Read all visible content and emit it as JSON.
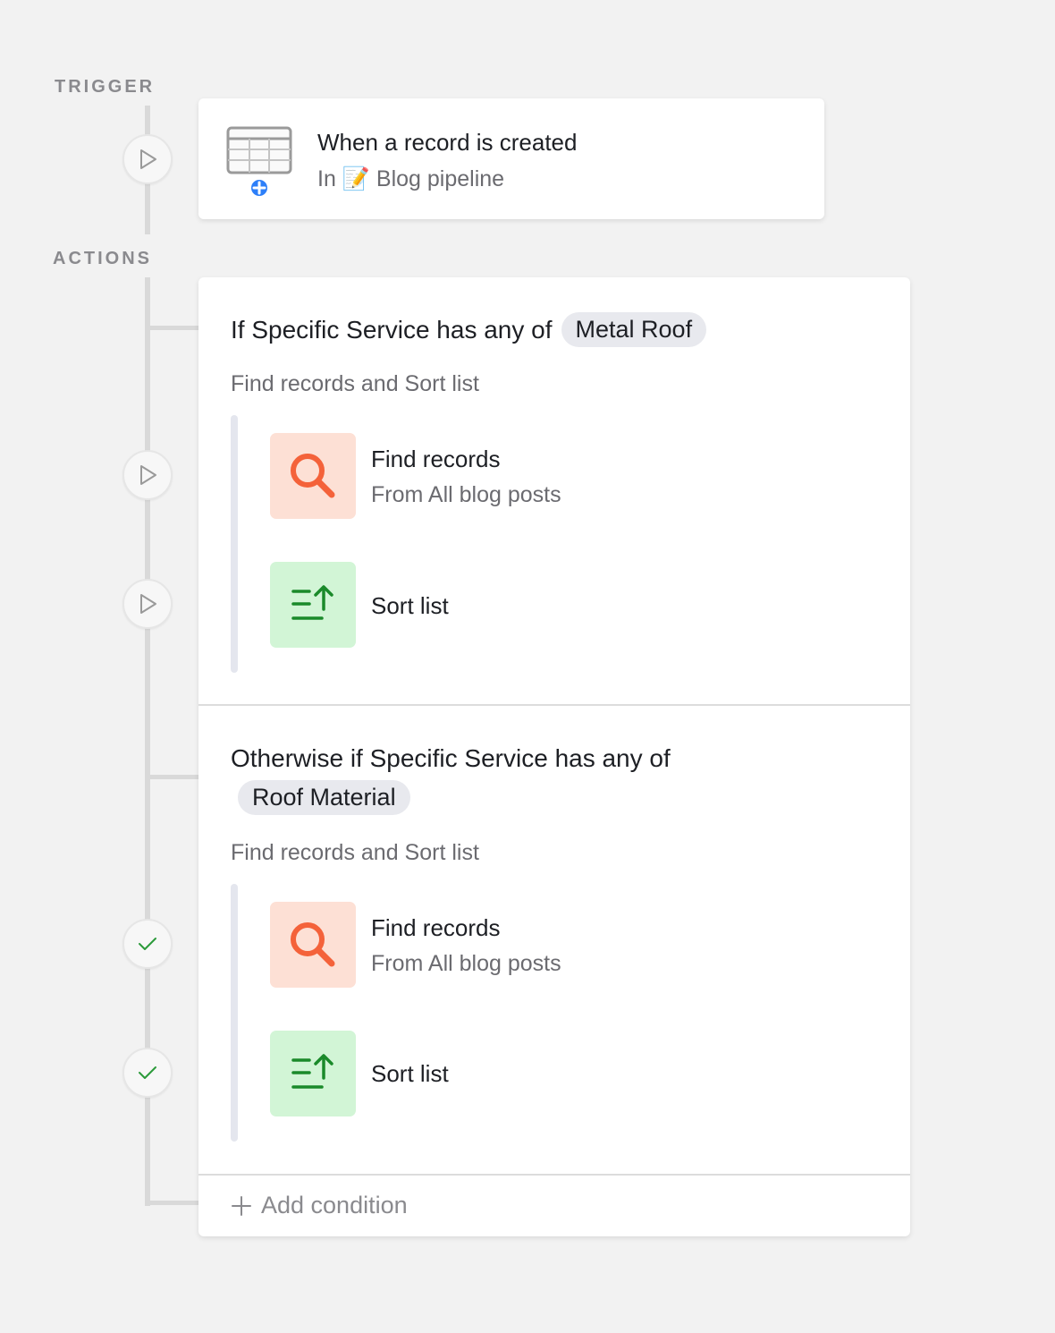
{
  "labels": {
    "trigger": "TRIGGER",
    "actions": "ACTIONS"
  },
  "trigger": {
    "title": "When a record is created",
    "subtitle_prefix": "In",
    "subtitle_emoji": "📝",
    "subtitle_table": "Blog pipeline",
    "icon": "table-add-icon"
  },
  "conditions": [
    {
      "title": "If Specific Service has any of",
      "value": "Metal Roof",
      "summary": "Find records and Sort list",
      "steps": [
        {
          "title": "Find records",
          "subtitle": "From All blog posts",
          "icon": "search-icon",
          "status": "pending"
        },
        {
          "title": "Sort list",
          "subtitle": "",
          "icon": "sort-ascending-icon",
          "status": "pending"
        }
      ]
    },
    {
      "title": "Otherwise if Specific Service has any of",
      "value": "Roof Material",
      "summary": "Find records and Sort list",
      "steps": [
        {
          "title": "Find records",
          "subtitle": "From All blog posts",
          "icon": "search-icon",
          "status": "done"
        },
        {
          "title": "Sort list",
          "subtitle": "",
          "icon": "sort-ascending-icon",
          "status": "done"
        }
      ]
    }
  ],
  "add_condition_label": "Add condition",
  "colors": {
    "find_tile": "#fde0d5",
    "find_icon": "#f4623a",
    "sort_tile": "#d2f5d6",
    "sort_icon": "#1a8a2a",
    "check": "#2b9a3a",
    "add_badge": "#2d7ff9"
  }
}
